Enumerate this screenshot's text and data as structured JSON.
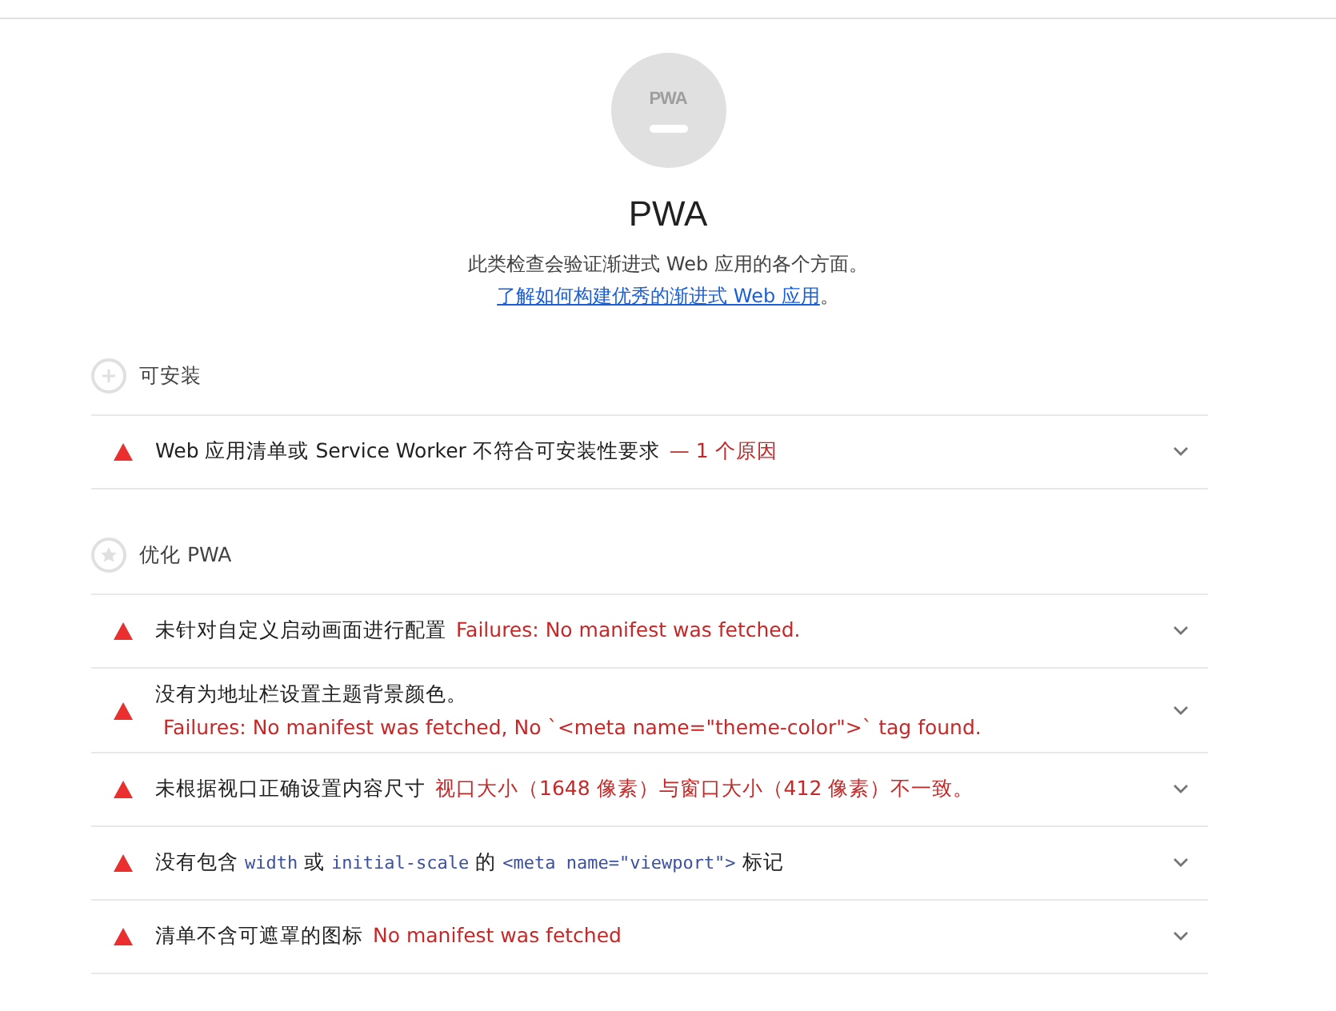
{
  "category": {
    "gauge_label": "PWA",
    "title": "PWA",
    "description": "此类检查会验证渐进式 Web 应用的各个方面。",
    "link": "了解如何构建优秀的渐进式 Web 应用",
    "description_end": "。"
  },
  "groups": [
    {
      "title": "可安装",
      "audits": [
        {
          "failed": true,
          "expanded": false,
          "title": [
            {
              "kind": "text",
              "text": "Web 应用清单或 Service Worker 不符合可安装性要求"
            }
          ],
          "detail": "— 1 个原因",
          "detail_below": false
        }
      ]
    },
    {
      "title": "优化 PWA",
      "audits": [
        {
          "failed": true,
          "expanded": false,
          "title": [
            {
              "kind": "text",
              "text": "未针对自定义启动画面进行配置"
            }
          ],
          "detail": "Failures: No manifest was fetched.",
          "detail_below": false
        },
        {
          "failed": true,
          "expanded": false,
          "title": [
            {
              "kind": "text",
              "text": "没有为地址栏设置主题背景颜色。"
            }
          ],
          "detail": "Failures: No manifest was fetched, No `<meta name=\"theme-color\">` tag found.",
          "detail_below": true
        },
        {
          "failed": true,
          "expanded": false,
          "title": [
            {
              "kind": "text",
              "text": "未根据视口正确设置内容尺寸"
            }
          ],
          "detail": "视口大小（1648 像素）与窗口大小（412 像素）不一致。",
          "detail_below": false
        },
        {
          "failed": true,
          "expanded": false,
          "title": [
            {
              "kind": "text",
              "text": "没有包含 "
            },
            {
              "kind": "code",
              "text": "width"
            },
            {
              "kind": "text",
              "text": " 或 "
            },
            {
              "kind": "code",
              "text": "initial-scale"
            },
            {
              "kind": "text",
              "text": " 的 "
            },
            {
              "kind": "code",
              "text": "<meta name=\"viewport\">"
            },
            {
              "kind": "text",
              "text": " 标记"
            }
          ]
        },
        {
          "failed": true,
          "expanded": false,
          "title": [
            {
              "kind": "text",
              "text": "清单不含可遮罩的图标"
            }
          ],
          "detail": "No manifest was fetched",
          "detail_below": false
        }
      ]
    }
  ]
}
